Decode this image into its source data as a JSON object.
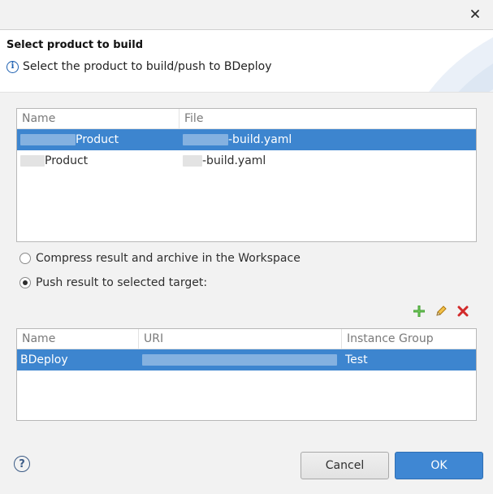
{
  "header": {
    "title": "Select product to build",
    "message": "Select the product to build/push to BDeploy"
  },
  "products_table": {
    "columns": [
      "Name",
      "File"
    ],
    "rows": [
      {
        "name": "Product",
        "file": "-build.yaml",
        "selected": true
      },
      {
        "name": "Product",
        "file": "-build.yaml",
        "selected": false
      }
    ]
  },
  "options": {
    "compress_label": "Compress result and archive in the Workspace",
    "push_label": "Push result to selected target:",
    "selected": "push"
  },
  "targets_table": {
    "columns": [
      "Name",
      "URI",
      "Instance Group"
    ],
    "rows": [
      {
        "name": "BDeploy",
        "uri": "",
        "instance_group": "Test",
        "selected": true
      }
    ]
  },
  "buttons": {
    "cancel": "Cancel",
    "ok": "OK"
  },
  "icons": {
    "close": "close-icon",
    "info": "info-icon",
    "add": "add-icon",
    "edit": "edit-icon",
    "remove": "remove-icon",
    "help": "help-icon"
  },
  "colors": {
    "selection": "#3d85cf",
    "ok_button": "#3f87d3",
    "add_icon": "#3a9b2a",
    "remove_icon": "#d22a2a",
    "edit_icon": "#e0a020"
  }
}
